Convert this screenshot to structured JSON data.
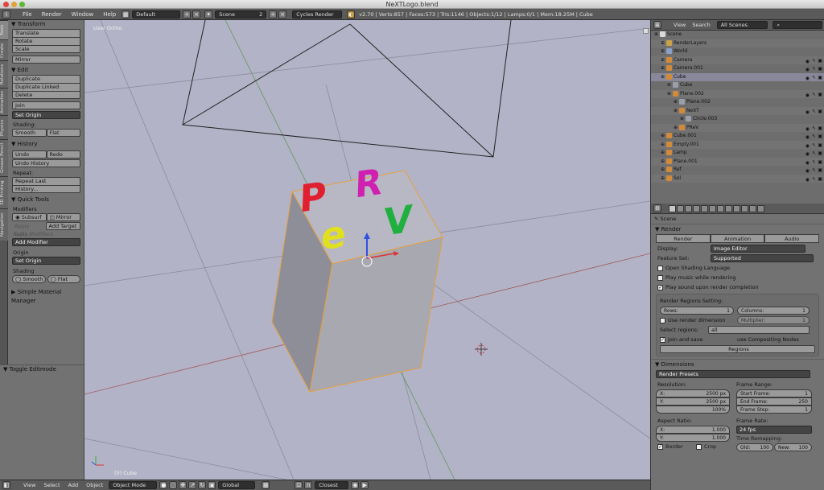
{
  "window": {
    "title": "NeXTLogo.blend"
  },
  "infobar": {
    "menus": [
      "File",
      "Render",
      "Window",
      "Help"
    ],
    "layout": "Default",
    "scene": "Scene",
    "scene_users": "2",
    "engine": "Cycles Render",
    "stats": "v2.70 | Verts:857 | Faces:573 | Tris:1146 | Objects:1/12 | Lamps:0/1 | Mem:18.25M | Cube"
  },
  "vtabs": [
    "Tools",
    "Create",
    "Relations",
    "Animation",
    "Physics",
    "Grease Pencil",
    "3D Printing",
    "Navigation"
  ],
  "toolshelf": {
    "transform": {
      "title": "Transform",
      "buttons": [
        "Translate",
        "Rotate",
        "Scale",
        "Mirror"
      ]
    },
    "edit": {
      "title": "Edit",
      "buttons": [
        "Duplicate",
        "Duplicate Linked",
        "Delete",
        "Join"
      ],
      "set_origin": "Set Origin",
      "shading_label": "Shading:",
      "smooth": "Smooth",
      "flat": "Flat"
    },
    "history": {
      "title": "History",
      "undo": "Undo",
      "redo": "Redo",
      "undo_history": "Undo History",
      "repeat_label": "Repeat:",
      "repeat_last": "Repeat Last",
      "history": "History..."
    },
    "quick": {
      "title": "Quick Tools",
      "modifiers_label": "Modifiers",
      "subsurf": "Subsurf",
      "mirror": "Mirror",
      "apply_subs": "Apply Subs...",
      "add_target": "Add Target",
      "apply_modifiers": "Apply Modifiers",
      "add_modifier": "Add Modifier",
      "origin_label": "Origin",
      "set_origin": "Set Origin",
      "shading_label": "Shading",
      "smooth": "Smooth",
      "flat": "Flat"
    },
    "simple_material": "Simple Material Manager",
    "toggle_editmode": "Toggle Editmode"
  },
  "viewport": {
    "label": "User Ortho",
    "object_label": "(0) Cube",
    "letters": [
      "P",
      "R",
      "e",
      "V"
    ]
  },
  "bottombar": {
    "items": [
      "View",
      "Select",
      "Add",
      "Object"
    ],
    "mode": "Object Mode",
    "orientation": "Global",
    "snap": "Closest"
  },
  "outliner": {
    "menus": [
      "View",
      "Search"
    ],
    "filter": "All Scenes",
    "rows": [
      {
        "name": "Scene",
        "indent": 0,
        "color": "#d8d8d8",
        "vis": false
      },
      {
        "name": "RenderLayers",
        "indent": 1,
        "color": "#c9a24a",
        "vis": false
      },
      {
        "name": "World",
        "indent": 1,
        "color": "#8aa0c8",
        "vis": false
      },
      {
        "name": "Camera",
        "indent": 1,
        "color": "#d08a3a",
        "vis": true
      },
      {
        "name": "Camera.001",
        "indent": 1,
        "color": "#d08a3a",
        "vis": true
      },
      {
        "name": "Cube",
        "indent": 1,
        "color": "#d08a3a",
        "vis": true,
        "sel": true
      },
      {
        "name": "Cube",
        "indent": 2,
        "color": "#9aa0aa",
        "vis": false
      },
      {
        "name": "Plane.002",
        "indent": 2,
        "color": "#d08a3a",
        "vis": true
      },
      {
        "name": "Plane.002",
        "indent": 3,
        "color": "#9aa0aa",
        "vis": false
      },
      {
        "name": "NeXT",
        "indent": 3,
        "color": "#d08a3a",
        "vis": true
      },
      {
        "name": "Circle.003",
        "indent": 4,
        "color": "#9aa0aa",
        "vis": false
      },
      {
        "name": "PReV",
        "indent": 3,
        "color": "#d08a3a",
        "vis": true
      },
      {
        "name": "Cube.001",
        "indent": 1,
        "color": "#d08a3a",
        "vis": true
      },
      {
        "name": "Empty.001",
        "indent": 1,
        "color": "#d08a3a",
        "vis": true
      },
      {
        "name": "Lamp",
        "indent": 1,
        "color": "#d08a3a",
        "vis": true
      },
      {
        "name": "Plane.001",
        "indent": 1,
        "color": "#d08a3a",
        "vis": true
      },
      {
        "name": "Ref",
        "indent": 1,
        "color": "#d08a3a",
        "vis": true
      },
      {
        "name": "Sol",
        "indent": 1,
        "color": "#d08a3a",
        "vis": true
      }
    ]
  },
  "properties": {
    "breadcrumb": "Scene",
    "render": {
      "title": "Render",
      "tabs": [
        "Render",
        "Animation",
        "Audio"
      ],
      "display_label": "Display:",
      "display_value": "Image Editor",
      "feature_label": "Feature Set:",
      "feature_value": "Supported",
      "open_shading": "Open Shading Language",
      "play_music": "Play music while rendering",
      "play_sound": "Play sound upon render completion",
      "regions_setting": "Render Regions Setting:",
      "rows_label": "Rows:",
      "rows_value": "1",
      "columns_label": "Columns:",
      "columns_value": "1",
      "use_dimension": "Use render dimension",
      "multiplier_label": "Multiplier:",
      "multiplier_value": "1",
      "select_regions_label": "Select regions:",
      "select_regions_value": "all",
      "join_save": "Join and save",
      "use_compositing": "use Compositing Nodes",
      "regions_button": "Regions"
    },
    "dimensions": {
      "title": "Dimensions",
      "presets": "Render Presets",
      "resolution_label": "Resolution:",
      "res_x_label": "X:",
      "res_x": "2500 px",
      "res_y_label": "Y:",
      "res_y": "2500 px",
      "res_pct": "100%",
      "frame_range_label": "Frame Range:",
      "start_label": "Start Frame:",
      "start": "1",
      "end_label": "End Frame:",
      "end": "250",
      "step_label": "Frame Step:",
      "step": "1",
      "aspect_label": "Aspect Ratio:",
      "asp_x_label": "X:",
      "asp_x": "1.000",
      "asp_y_label": "Y:",
      "asp_y": "1.000",
      "frame_rate_label": "Frame Rate:",
      "frame_rate": "24 fps",
      "remap_label": "Time Remapping:",
      "old_label": "Old:",
      "old": "100",
      "new_label": "New:",
      "new": "100",
      "border": "Border",
      "crop": "Crop"
    }
  },
  "colors": {
    "letter_p": "#e02030",
    "letter_r": "#d020b0",
    "letter_e": "#e0e020",
    "letter_v": "#20b040"
  }
}
